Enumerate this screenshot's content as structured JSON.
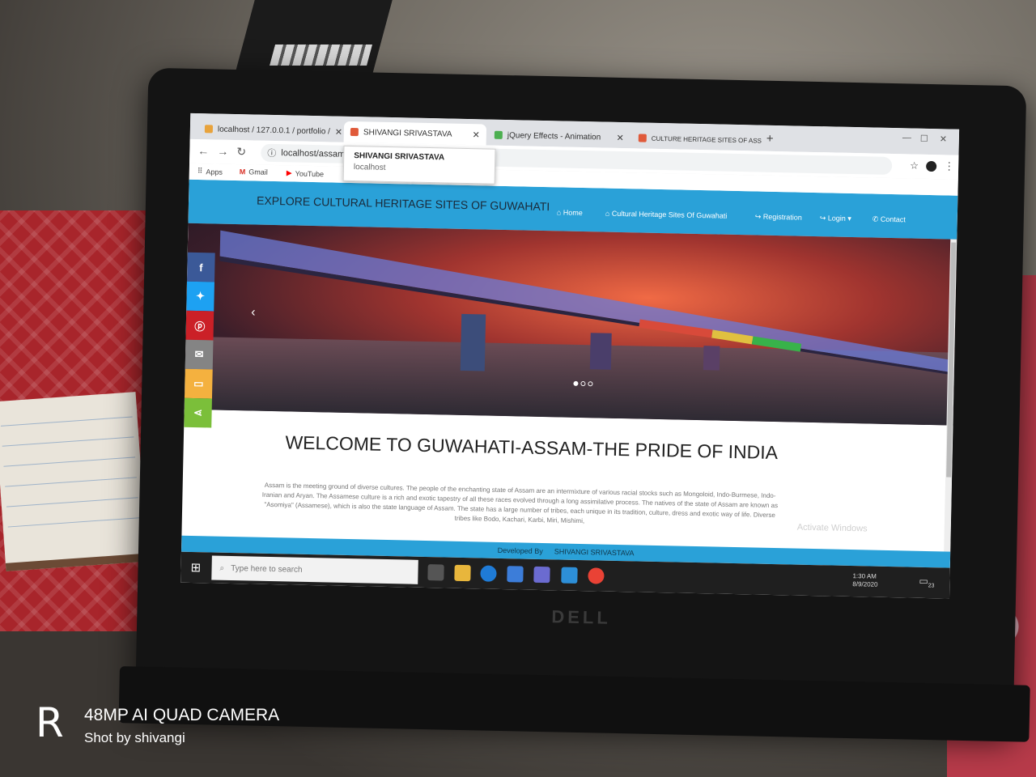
{
  "browser": {
    "tabs": [
      {
        "title": "localhost / 127.0.0.1 / portfolio /",
        "favicon_color": "#e8a33c",
        "active": false
      },
      {
        "title": "SHIVANGI SRIVASTAVA",
        "favicon_color": "#e05a3a",
        "active": true
      },
      {
        "title": "jQuery Effects - Animation",
        "favicon_color": "#4caf50",
        "active": false
      },
      {
        "title": "CULTURE HERITAGE SITES OF ASS",
        "favicon_color": "#e05a3a",
        "active": false
      }
    ],
    "tooltip": {
      "title": "SHIVANGI SRIVASTAVA",
      "host": "localhost"
    },
    "address": "localhost/assam",
    "bookmarks": [
      "Apps",
      "Gmail",
      "YouTube"
    ]
  },
  "site": {
    "title": "EXPLORE CULTURAL HERITAGE SITES OF GUWAHATI",
    "nav": [
      "Home",
      "Cultural Heritage Sites Of Guwahati",
      "Registration",
      "Login",
      "Contact"
    ],
    "welcome": "WELCOME TO GUWAHATI-ASSAM-THE PRIDE OF INDIA",
    "paragraph": "Assam is the meeting ground of diverse cultures. The people of the enchanting state of Assam are an intermixture of various racial stocks such as Mongoloid, Indo-Burmese, Indo-Iranian and Aryan. The Assamese culture is a rich and exotic tapestry of all these races evolved through a long assimilative process. The natives of the state of Assam are known as \"Asomiya\" (Assamese), which is also the state language of Assam. The state has a large number of tribes, each unique in its tradition, culture, dress and exotic way of life. Diverse tribes like Bodo, Kachari, Karbi, Miri, Mishimi,",
    "footer_label": "Developed By",
    "footer_name": "SHIVANGI SRIVASTAVA",
    "watermark": "Activate Windows",
    "share_colors": [
      "#3b5998",
      "#1da1f2",
      "#cb2027",
      "#848484",
      "#f4b13f",
      "#7bbf3a"
    ]
  },
  "taskbar": {
    "search_placeholder": "Type here to search",
    "time": "1:30 AM",
    "date": "8/9/2020",
    "notifications": "23"
  },
  "camera": {
    "line1": "48MP AI QUAD CAMERA",
    "line2": "Shot by shivangi"
  },
  "device": {
    "brand": "DELL"
  }
}
